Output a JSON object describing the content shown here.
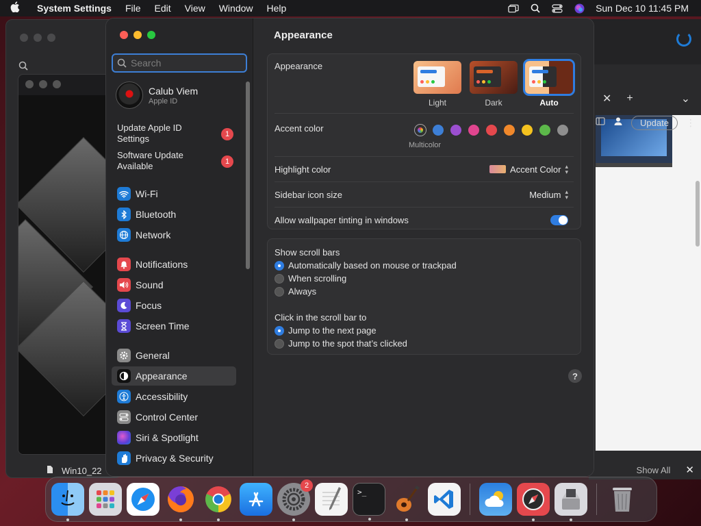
{
  "menubar": {
    "app_name": "System Settings",
    "items": [
      "File",
      "Edit",
      "View",
      "Window",
      "Help"
    ],
    "clock": "Sun Dec 10  11:45 PM"
  },
  "background": {
    "left_file_label": "Win10_22",
    "right_update_label": "Update",
    "right_show_all": "Show All"
  },
  "sidebar": {
    "search_placeholder": "Search",
    "account_name": "Calub Viem",
    "account_sub": "Apple ID",
    "notices": [
      {
        "label": "Update Apple ID Settings",
        "badge": "1"
      },
      {
        "label": "Software Update Available",
        "badge": "1"
      }
    ],
    "items": [
      {
        "label": "Wi-Fi",
        "icon": "wifi-icon",
        "color": "#1e7bd6"
      },
      {
        "label": "Bluetooth",
        "icon": "bluetooth-icon",
        "color": "#1e7bd6"
      },
      {
        "label": "Network",
        "icon": "globe-icon",
        "color": "#1e7bd6"
      },
      {
        "label": "Notifications",
        "icon": "bell-icon",
        "color": "#e5484d"
      },
      {
        "label": "Sound",
        "icon": "speaker-icon",
        "color": "#e5484d"
      },
      {
        "label": "Focus",
        "icon": "moon-icon",
        "color": "#5b4bd6"
      },
      {
        "label": "Screen Time",
        "icon": "hourglass-icon",
        "color": "#5b4bd6"
      },
      {
        "label": "General",
        "icon": "gear-icon",
        "color": "#8a8a8a"
      },
      {
        "label": "Appearance",
        "icon": "appearance-icon",
        "color": "#111111"
      },
      {
        "label": "Accessibility",
        "icon": "accessibility-icon",
        "color": "#1e7bd6"
      },
      {
        "label": "Control Center",
        "icon": "control-center-icon",
        "color": "#8a8a8a"
      },
      {
        "label": "Siri & Spotlight",
        "icon": "siri-icon",
        "color": "#b33fd6"
      },
      {
        "label": "Privacy & Security",
        "icon": "hand-icon",
        "color": "#1e7bd6"
      }
    ],
    "selected": "Appearance"
  },
  "content": {
    "title": "Appearance",
    "appearance_label": "Appearance",
    "themes": [
      "Light",
      "Dark",
      "Auto"
    ],
    "selected_theme": "Auto",
    "accent_label": "Accent color",
    "accent_caption": "Multicolor",
    "accent_colors": [
      "#3d7fd6",
      "#9b4fd0",
      "#e0458f",
      "#e5484d",
      "#f0882b",
      "#f4c21f",
      "#5cb84a",
      "#8e8e8e"
    ],
    "highlight_label": "Highlight color",
    "highlight_value": "Accent Color",
    "sidebar_size_label": "Sidebar icon size",
    "sidebar_size_value": "Medium",
    "wallpaper_label": "Allow wallpaper tinting in windows",
    "scroll_bars_label": "Show scroll bars",
    "scroll_bars_options": [
      "Automatically based on mouse or trackpad",
      "When scrolling",
      "Always"
    ],
    "scroll_click_label": "Click in the scroll bar to",
    "scroll_click_options": [
      "Jump to the next page",
      "Jump to the spot that’s clicked"
    ],
    "help": "?"
  },
  "dock": {
    "settings_badge": "2",
    "apps": [
      "finder-icon",
      "launchpad-icon",
      "safari-icon",
      "firefox-icon",
      "chrome-icon",
      "app-store-icon",
      "system-settings-icon",
      "textedit-icon",
      "terminal-icon",
      "garageband-icon",
      "vscode-icon",
      "weather-icon",
      "compass-icon",
      "vm-icon",
      "trash-icon"
    ]
  }
}
